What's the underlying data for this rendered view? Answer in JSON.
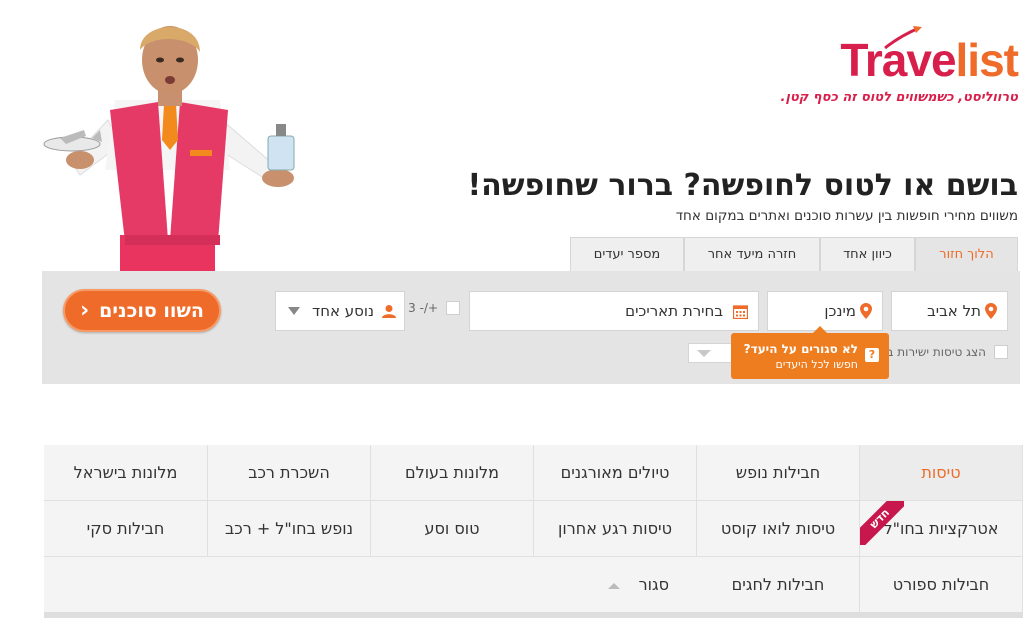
{
  "brand": {
    "logo_part1": "Trave",
    "logo_part2": "list",
    "tagline": "טרווליסט, כשמשווים לטוס זה כסף קטן.",
    "colors": {
      "primary": "#d81e4b",
      "accent": "#ee6b2a",
      "tooltip": "#ee7d1f"
    }
  },
  "hero": {
    "headline": "בושם או לטוס לחופשה? ברור שחופשה!",
    "subheadline": "משווים מחירי חופשות בין עשרות סוכנים ואתרים במקום אחד"
  },
  "search": {
    "tabs": [
      {
        "label": "הלוך חזור",
        "active": true
      },
      {
        "label": "כיוון אחד",
        "active": false
      },
      {
        "label": "חזרה מיעד אחר",
        "active": false
      },
      {
        "label": "מספר יעדים",
        "active": false
      }
    ],
    "origin": {
      "value": "תל אביב",
      "icon": "location-pin-icon"
    },
    "destination": {
      "value": "מינכן",
      "icon": "location-pin-icon"
    },
    "dates": {
      "placeholder": "בחירת תאריכים",
      "icon": "calendar-icon"
    },
    "flex_days": {
      "label": "+/- 3 ימים",
      "checked": false
    },
    "travelers": {
      "value": "נוסע אחד",
      "icon": "person-icon"
    },
    "compare_button": "השוו סוכנים",
    "direct_flights": {
      "label": "הצג טיסות ישירות ב",
      "checked": false
    },
    "tooltip": {
      "title": "לא סגורים על היעד?",
      "subtitle": "חפשו לכל היעדים",
      "icon": "question-icon"
    }
  },
  "categories": {
    "new_badge": "חדש",
    "closed_label": "סגור",
    "rows": [
      [
        "טיסות",
        "חבילות נופש",
        "טיולים מאורגנים",
        "מלונות בעולם",
        "השכרת רכב",
        "מלונות בישראל"
      ],
      [
        "אטרקציות בחו\"ל",
        "טיסות לואו קוסט",
        "טיסות רגע אחרון",
        "טוס וסע",
        "נופש בחו\"ל + רכב",
        "חבילות סקי"
      ],
      [
        "חבילות ספורט",
        "חבילות לחגים"
      ]
    ]
  }
}
